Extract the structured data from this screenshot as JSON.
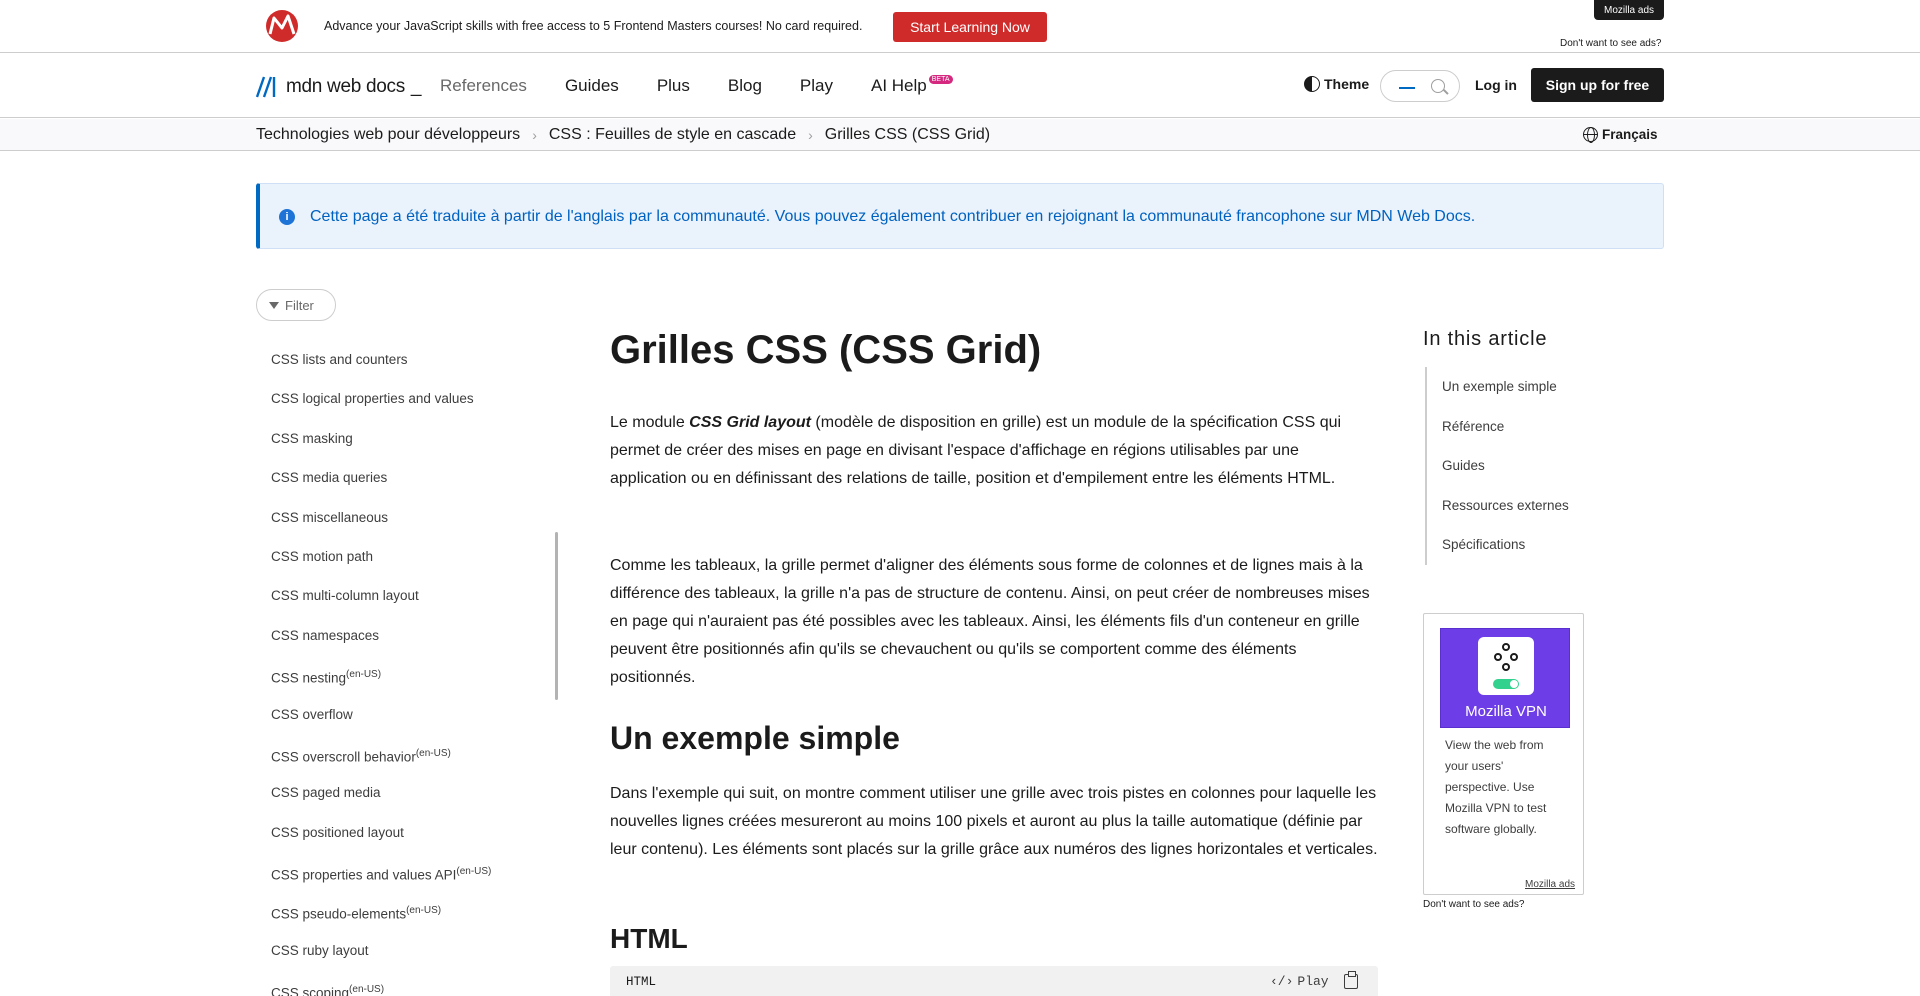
{
  "ad_banner": {
    "text": "Advance your JavaScript skills with free access to 5 Frontend Masters courses! No card required.",
    "cta": "Start Learning Now",
    "badge": "Mozilla ads",
    "no_ads": "Don't want to see ads?",
    "brand_color": "#d02b2b"
  },
  "header": {
    "logo_text": "mdn web docs",
    "nav": [
      "References",
      "Guides",
      "Plus",
      "Blog",
      "Play",
      "AI Help"
    ],
    "beta_badge": "BETA",
    "theme_label": "Theme",
    "login": "Log in",
    "signup": "Sign up for free"
  },
  "breadcrumb": {
    "items": [
      "Technologies web pour développeurs",
      "CSS : Feuilles de style en cascade",
      "Grilles CSS (CSS Grid)"
    ],
    "language": "Français"
  },
  "notice": {
    "text": "Cette page a été traduite à partir de l'anglais par la communauté. Vous pouvez également contribuer en rejoignant la communauté francophone sur MDN Web Docs."
  },
  "sidebar": {
    "filter_label": "Filter",
    "items": [
      {
        "label": "CSS lists and counters",
        "sup": ""
      },
      {
        "label": "CSS logical properties and values",
        "sup": ""
      },
      {
        "label": "CSS masking",
        "sup": ""
      },
      {
        "label": "CSS media queries",
        "sup": ""
      },
      {
        "label": "CSS miscellaneous",
        "sup": ""
      },
      {
        "label": "CSS motion path",
        "sup": ""
      },
      {
        "label": "CSS multi-column layout",
        "sup": ""
      },
      {
        "label": "CSS namespaces",
        "sup": ""
      },
      {
        "label": "CSS nesting",
        "sup": "(en-US)"
      },
      {
        "label": "CSS overflow",
        "sup": ""
      },
      {
        "label": "CSS overscroll behavior",
        "sup": "(en-US)"
      },
      {
        "label": "CSS paged media",
        "sup": ""
      },
      {
        "label": "CSS positioned layout",
        "sup": ""
      },
      {
        "label": "CSS properties and values API",
        "sup": "(en-US)"
      },
      {
        "label": "CSS pseudo-elements",
        "sup": "(en-US)"
      },
      {
        "label": "CSS ruby layout",
        "sup": ""
      },
      {
        "label": "CSS scoping",
        "sup": "(en-US)"
      }
    ]
  },
  "article": {
    "title": "Grilles CSS (CSS Grid)",
    "p1_before": "Le module ",
    "p1_em": "CSS Grid layout",
    "p1_after": " (modèle de disposition en grille) est un module de la spécification CSS qui permet de créer des mises en page en divisant l'espace d'affichage en régions utilisables par une application ou en définissant des relations de taille, position et d'empilement entre les éléments HTML.",
    "p2": "Comme les tableaux, la grille permet d'aligner des éléments sous forme de colonnes et de lignes mais à la différence des tableaux, la grille n'a pas de structure de contenu. Ainsi, on peut créer de nombreuses mises en page qui n'auraient pas été possibles avec les tableaux. Ainsi, les éléments fils d'un conteneur en grille peuvent être positionnés afin qu'ils se chevauchent ou qu'ils se comportent comme des éléments positionnés.",
    "h2": "Un exemple simple",
    "p3": "Dans l'exemple qui suit, on montre comment utiliser une grille avec trois pistes en colonnes pour laquelle les nouvelles lignes créées mesureront au moins 100 pixels et auront au plus la taille automatique (définie par leur contenu). Les éléments sont placés sur la grille grâce aux numéros des lignes horizontales et verticales.",
    "h3": "HTML",
    "code_lang": "HTML",
    "play_label": "Play"
  },
  "toc": {
    "title": "In this article",
    "items": [
      "Un exemple simple",
      "Référence",
      "Guides",
      "Ressources externes",
      "Spécifications"
    ]
  },
  "side_ad": {
    "product": "Mozilla VPN",
    "copy": "View the web from your users' perspective. Use Mozilla VPN to test software globally.",
    "footer": "Mozilla ads",
    "no_ads": "Don't want to see ads?",
    "accent": "#6d3de8"
  }
}
